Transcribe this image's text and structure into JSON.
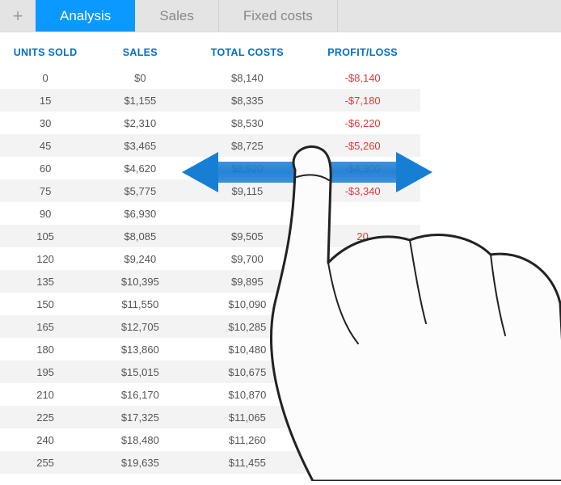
{
  "tabs": {
    "plus_icon": "+",
    "items": [
      {
        "label": "Analysis",
        "active": true
      },
      {
        "label": "Sales",
        "active": false
      },
      {
        "label": "Fixed costs",
        "active": false
      }
    ]
  },
  "table": {
    "headers": [
      "UNITS SOLD",
      "SALES",
      "TOTAL COSTS",
      "PROFIT/LOSS"
    ],
    "rows": [
      {
        "cells": [
          "0",
          "$0",
          "$8,140",
          "-$8,140"
        ],
        "negative": true
      },
      {
        "cells": [
          "15",
          "$1,155",
          "$8,335",
          "-$7,180"
        ],
        "negative": true
      },
      {
        "cells": [
          "30",
          "$2,310",
          "$8,530",
          "-$6,220"
        ],
        "negative": true
      },
      {
        "cells": [
          "45",
          "$3,465",
          "$8,725",
          "-$5,260"
        ],
        "negative": true
      },
      {
        "cells": [
          "60",
          "$4,620",
          "$8,920",
          "-$4,300"
        ],
        "negative": true
      },
      {
        "cells": [
          "75",
          "$5,775",
          "$9,115",
          "-$3,340"
        ],
        "negative": true
      },
      {
        "cells": [
          "90",
          "$6,930",
          "",
          ""
        ],
        "negative": false
      },
      {
        "cells": [
          "105",
          "$8,085",
          "$9,505",
          "20"
        ],
        "negative": true
      },
      {
        "cells": [
          "120",
          "$9,240",
          "$9,700",
          ""
        ],
        "negative": false
      },
      {
        "cells": [
          "135",
          "$10,395",
          "$9,895",
          ""
        ],
        "negative": false
      },
      {
        "cells": [
          "150",
          "$11,550",
          "$10,090",
          ""
        ],
        "negative": false
      },
      {
        "cells": [
          "165",
          "$12,705",
          "$10,285",
          ""
        ],
        "negative": false
      },
      {
        "cells": [
          "180",
          "$13,860",
          "$10,480",
          ""
        ],
        "negative": false
      },
      {
        "cells": [
          "195",
          "$15,015",
          "$10,675",
          ""
        ],
        "negative": false
      },
      {
        "cells": [
          "210",
          "$16,170",
          "$10,870",
          ""
        ],
        "negative": false
      },
      {
        "cells": [
          "225",
          "$17,325",
          "$11,065",
          ""
        ],
        "negative": false
      },
      {
        "cells": [
          "240",
          "$18,480",
          "$11,260",
          ""
        ],
        "negative": false
      },
      {
        "cells": [
          "255",
          "$19,635",
          "$11,455",
          ""
        ],
        "negative": false
      }
    ]
  },
  "overlay": {
    "gesture": "swipe-horizontal",
    "arrow_color": "#167fd3"
  }
}
